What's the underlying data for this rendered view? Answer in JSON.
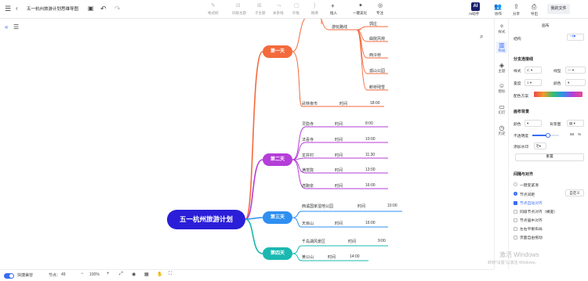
{
  "title": "五一杭州旅游计划思维导图",
  "toolbar": {
    "tools": [
      "格式刷",
      "同级主题",
      "子主题",
      "关系线",
      "外框",
      "概要",
      "插入",
      "一键美化",
      "专注"
    ],
    "ai_label": "AI助手",
    "collab_label": "协作",
    "share_label": "分享",
    "export_label": "导出",
    "my_files": "我的文件"
  },
  "side_tabs": [
    "样式",
    "布局",
    "主题",
    "图标",
    "幻灯",
    "历史"
  ],
  "panel": {
    "header": "画布",
    "structure_label": "结构",
    "branch_section": "分支连接线",
    "style_label": "样式",
    "line_label": "线型",
    "width_label": "宽度",
    "color_label": "颜色",
    "scheme_label": "配色方案",
    "canvas_section": "画布背景",
    "bg_color_label": "颜色",
    "bg_image_label": "背景图",
    "opacity_label": "不透明度",
    "opacity_value": "60",
    "opacity_unit": "%",
    "watermark_label": "添加水印",
    "reset_label": "重置",
    "layout_section": "间隔与对齐",
    "one_click_label": "一键变紧凑",
    "node_spacing_label": "节点间距",
    "custom_label": "自定义",
    "auto_align": "节点自动对齐",
    "same_level_width": "同级节点对齐（横宽）",
    "same_level_center": "节点居中对齐",
    "left_right_balance": "左右平衡布局",
    "canvas_drag": "页面自由拖动"
  },
  "mindmap": {
    "root": "五一杭州旅游计划",
    "days": [
      "第一天",
      "第二天",
      "第三天",
      "第四天"
    ],
    "day1_top_items": [
      "游玩路线",
      "郭庄",
      "曲院风荷",
      "西泠桥",
      "孤山公园",
      "断桥残雪"
    ],
    "day1_row": {
      "place": "武林夜市",
      "time_label": "时间",
      "time": "18:00"
    },
    "day2_rows": [
      {
        "place": "灵隐寺",
        "time_label": "时间",
        "time": "8:00"
      },
      {
        "place": "法喜寺",
        "time_label": "时间",
        "time": "10:00"
      },
      {
        "place": "龙井村",
        "time_label": "时间",
        "time": "11:30"
      },
      {
        "place": "满觉陇",
        "time_label": "时间",
        "time": "13:00"
      },
      {
        "place": "虎跑泉",
        "time_label": "时间",
        "time": "16:00"
      }
    ],
    "day3_rows": [
      {
        "place": "西溪国家湿地公园",
        "time_label": "时间",
        "time": "10:00"
      },
      {
        "place": "天目山",
        "time_label": "时间",
        "time": "16:00"
      }
    ],
    "day4_rows": [
      {
        "place": "千岛湖风景区",
        "time_label": "时间",
        "time": "9:00"
      },
      {
        "place": "黄公山",
        "time_label": "时间",
        "time": "14:00"
      }
    ]
  },
  "bottom": {
    "follow_label": "快捷兼容",
    "nodes_label": "节点：",
    "nodes_count": "49",
    "zoom": "100%"
  },
  "watermark": {
    "line1": "激活 Windows",
    "line2": "转到\"设置\"以激活 Windows。"
  },
  "colors": {
    "accent": "#3a6cf4",
    "root": "#2a1ed8",
    "day1": "#f46a3c",
    "day2": "#b43ed8",
    "day3": "#2f8ff0",
    "day4": "#19b8b0"
  }
}
